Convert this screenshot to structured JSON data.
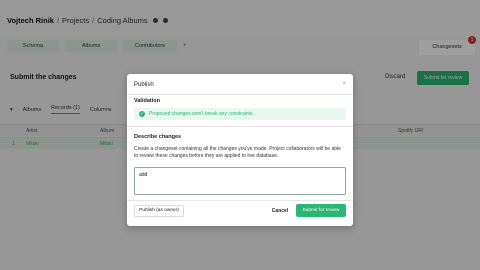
{
  "breadcrumb": {
    "owner": "Vojtech Rinik",
    "sep1": "/",
    "section": "Projects",
    "sep2": "/",
    "project": "Coding Albums"
  },
  "tabs": [
    "Schema",
    "Albums",
    "Contributors"
  ],
  "tab_add": "+",
  "changesets": {
    "label": "Changesets",
    "count": "1"
  },
  "page": {
    "title": "Submit the changes",
    "discard_label": "Discard",
    "submit_review_label": "Submit for review"
  },
  "subtabs": {
    "albums": "Albums",
    "records": "Records (1)",
    "columns": "Columns"
  },
  "grid": {
    "headers": [
      "Artist",
      "Album",
      "Spotify URI"
    ],
    "row": {
      "index": "1",
      "artist": "Mitski",
      "album": "Mitski"
    }
  },
  "modal": {
    "title": "Publish",
    "close": "×",
    "validation_label": "Validation",
    "validation_message": "Proposed changes won't break any constraints.",
    "describe_label": "Describe changes",
    "describe_help": "Create a changeset containing all the changes you've made. Project collaborators will be able to review these changes before they are applied to live database.",
    "textarea_value": "add",
    "publish_owner_label": "Publish (as owner)",
    "cancel_label": "Cancel",
    "submit_review_label": "Submit for review"
  },
  "colors": {
    "accent": "#2bb673",
    "badge": "#dd3333"
  }
}
